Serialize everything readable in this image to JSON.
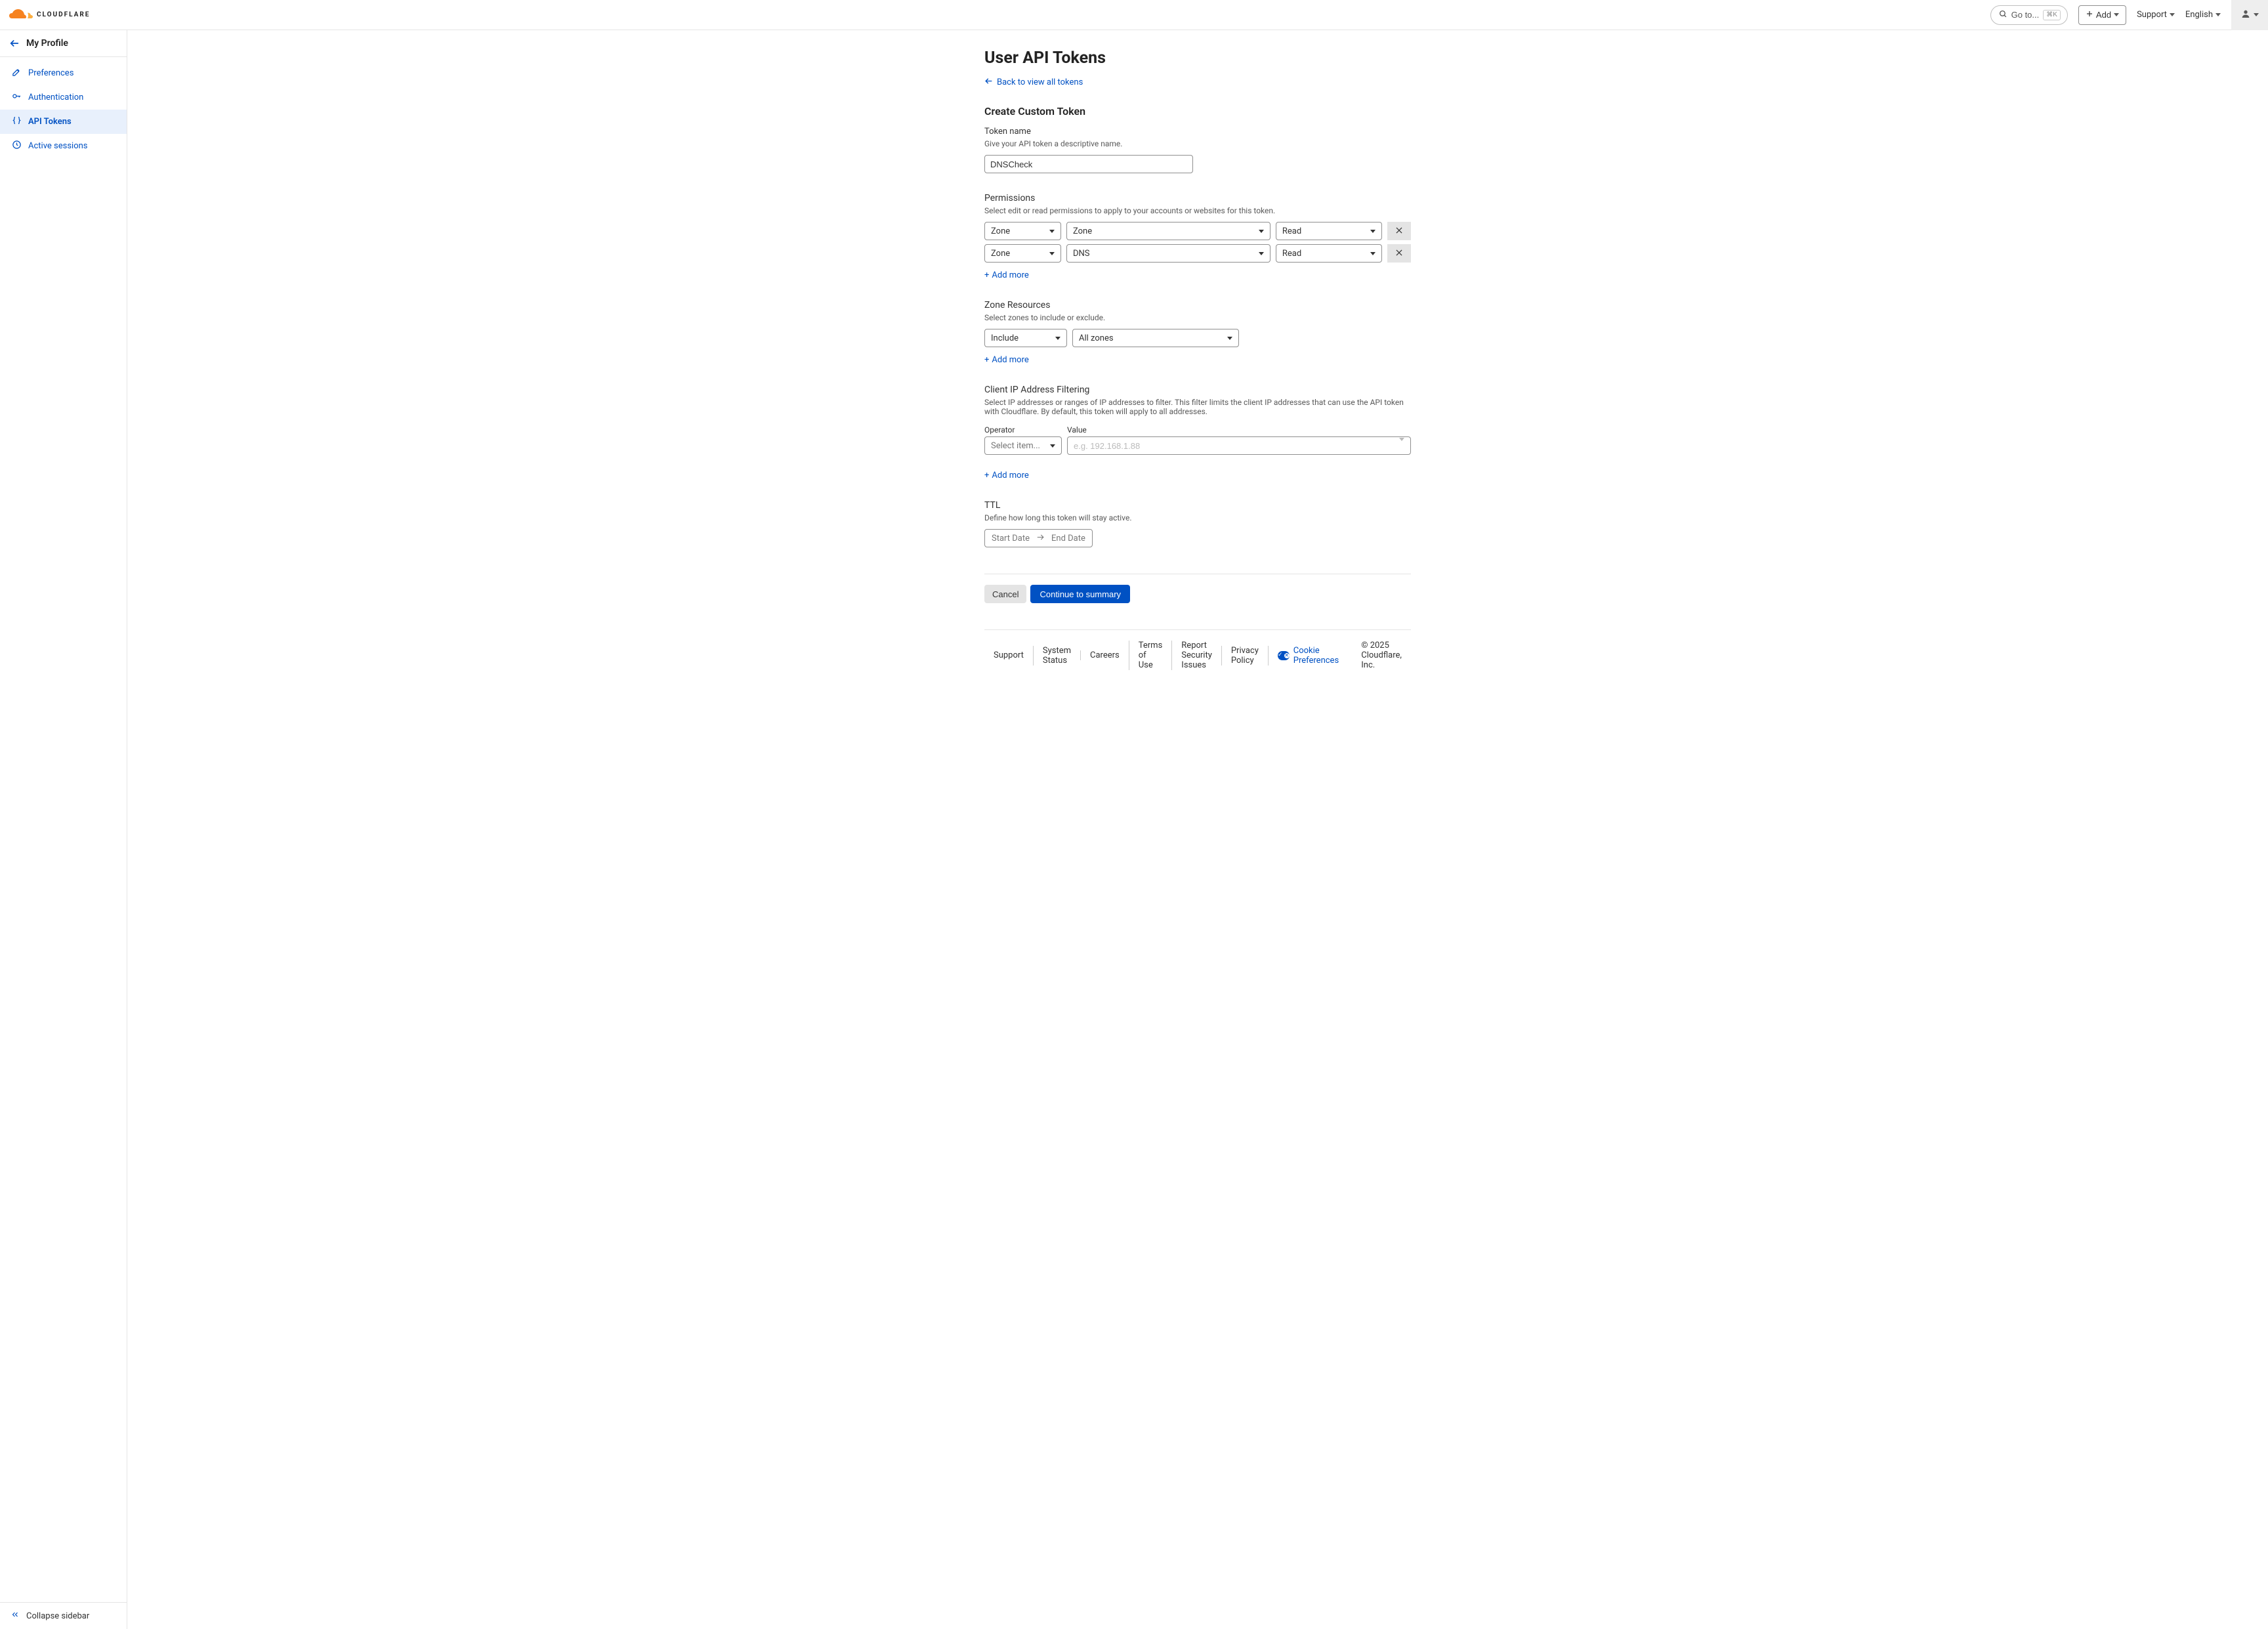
{
  "header": {
    "logo_text": "CLOUDFLARE",
    "goto_label": "Go to...",
    "goto_kbd": "⌘K",
    "add_label": "Add",
    "support_label": "Support",
    "language_label": "English"
  },
  "sidebar": {
    "back_title": "My Profile",
    "items": [
      {
        "label": "Preferences"
      },
      {
        "label": "Authentication"
      },
      {
        "label": "API Tokens"
      },
      {
        "label": "Active sessions"
      }
    ],
    "collapse_label": "Collapse sidebar"
  },
  "page": {
    "title": "User API Tokens",
    "back_link": "Back to view all tokens",
    "sections": {
      "create_title": "Create Custom Token",
      "token_name": {
        "label": "Token name",
        "help": "Give your API token a descriptive name.",
        "value": "DNSCheck"
      },
      "permissions": {
        "title": "Permissions",
        "help": "Select edit or read permissions to apply to your accounts or websites for this token.",
        "rows": [
          {
            "scope": "Zone",
            "resource": "Zone",
            "access": "Read"
          },
          {
            "scope": "Zone",
            "resource": "DNS",
            "access": "Read"
          }
        ],
        "add_more": "Add more"
      },
      "zone_resources": {
        "title": "Zone Resources",
        "help": "Select zones to include or exclude.",
        "row": {
          "operator": "Include",
          "value": "All zones"
        },
        "add_more": "Add more"
      },
      "ip_filter": {
        "title": "Client IP Address Filtering",
        "help": "Select IP addresses or ranges of IP addresses to filter. This filter limits the client IP addresses that can use the API token with Cloudflare. By default, this token will apply to all addresses.",
        "operator_label": "Operator",
        "value_label": "Value",
        "operator_placeholder": "Select item...",
        "value_placeholder": "e.g. 192.168.1.88",
        "add_more": "Add more"
      },
      "ttl": {
        "title": "TTL",
        "help": "Define how long this token will stay active.",
        "start": "Start Date",
        "end": "End Date"
      },
      "buttons": {
        "cancel": "Cancel",
        "continue": "Continue to summary"
      }
    }
  },
  "footer": {
    "links": [
      "Support",
      "System Status",
      "Careers",
      "Terms of Use",
      "Report Security Issues",
      "Privacy Policy"
    ],
    "cookie_label": "Cookie Preferences",
    "copyright": "© 2025 Cloudflare, Inc."
  }
}
